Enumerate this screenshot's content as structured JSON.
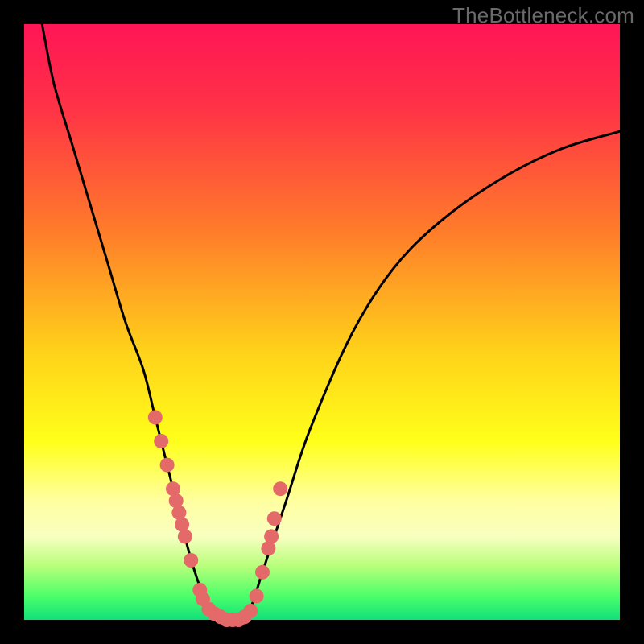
{
  "watermark": "TheBottleneck.com",
  "colors": {
    "frame": "#000000",
    "gradient_stops": [
      {
        "pct": 0,
        "color": "#ff1556"
      },
      {
        "pct": 14,
        "color": "#ff3246"
      },
      {
        "pct": 35,
        "color": "#ff7d2a"
      },
      {
        "pct": 55,
        "color": "#ffd21a"
      },
      {
        "pct": 70,
        "color": "#ffff1a"
      },
      {
        "pct": 80,
        "color": "#ffffa0"
      },
      {
        "pct": 86,
        "color": "#f8ffc0"
      },
      {
        "pct": 91,
        "color": "#b7ff7a"
      },
      {
        "pct": 96,
        "color": "#4cff6a"
      },
      {
        "pct": 100,
        "color": "#12e07a"
      }
    ],
    "curve": "#000000",
    "marker_fill": "#e46a6a",
    "marker_stroke": "#c64f4f"
  },
  "chart_data": {
    "type": "line",
    "title": "",
    "xlabel": "",
    "ylabel": "",
    "xlim": [
      0,
      100
    ],
    "ylim": [
      0,
      100
    ],
    "series": [
      {
        "name": "bottleneck-curve",
        "x": [
          3,
          5,
          8,
          11,
          14,
          17,
          20,
          22,
          24,
          26,
          27.5,
          29,
          30.5,
          32,
          34,
          36,
          38,
          40,
          44,
          48,
          55,
          62,
          70,
          80,
          90,
          100
        ],
        "values": [
          100,
          90,
          80,
          70,
          60,
          50,
          42,
          34,
          26,
          18,
          12,
          7,
          3,
          1,
          0,
          0,
          2,
          8,
          20,
          32,
          48,
          59,
          67,
          74,
          79,
          82
        ]
      }
    ],
    "markers": {
      "name": "highlighted-points",
      "x": [
        22,
        23,
        24,
        25,
        25.5,
        26,
        26.5,
        27,
        28,
        29.5,
        30,
        31,
        32,
        33,
        34,
        35,
        36,
        37,
        38,
        39,
        40,
        41,
        41.5,
        42,
        43
      ],
      "values": [
        34,
        30,
        26,
        22,
        20,
        18,
        16,
        14,
        10,
        5,
        3.5,
        1.8,
        1,
        0.5,
        0,
        0,
        0,
        0.5,
        1.5,
        4,
        8,
        12,
        14,
        17,
        22
      ]
    }
  }
}
